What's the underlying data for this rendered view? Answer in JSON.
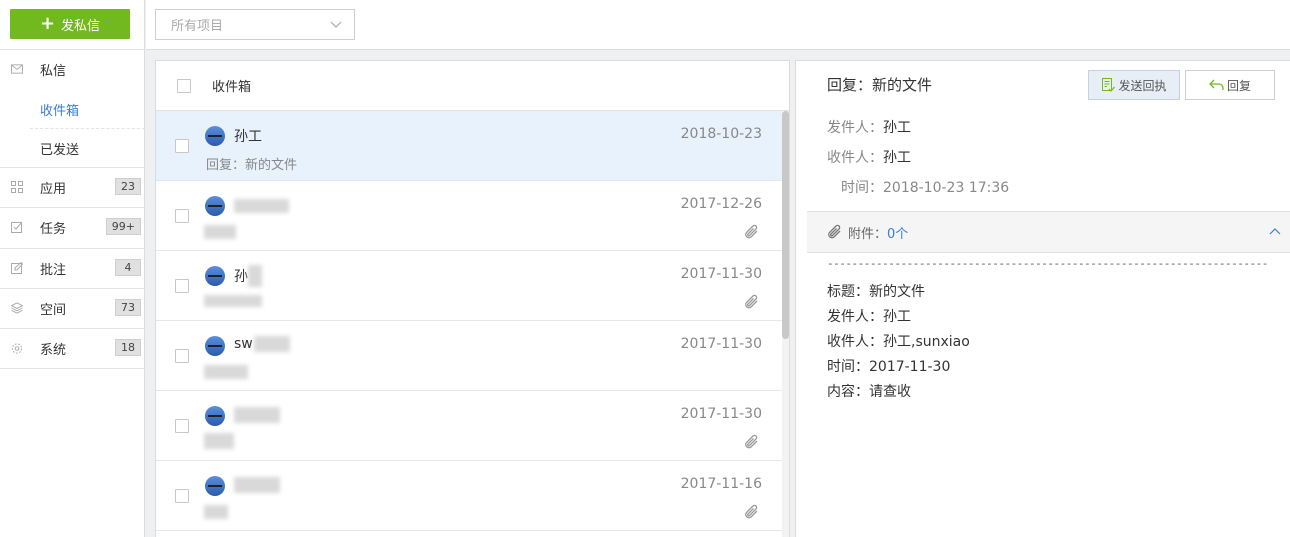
{
  "sidebar": {
    "compose_label": "发私信",
    "sections": [
      {
        "label": "私信",
        "icon": "mail-icon"
      },
      {
        "label": "应用",
        "icon": "apps-icon",
        "badge": "23"
      },
      {
        "label": "任务",
        "icon": "task-icon",
        "badge": "99+"
      },
      {
        "label": "批注",
        "icon": "annotation-icon",
        "badge": "4"
      },
      {
        "label": "空间",
        "icon": "layers-icon",
        "badge": "73"
      },
      {
        "label": "系统",
        "icon": "gear-icon",
        "badge": "18"
      }
    ],
    "sub_items": [
      {
        "label": "收件箱",
        "active": true
      },
      {
        "label": "已发送",
        "active": false
      }
    ]
  },
  "topbar": {
    "filter_placeholder": "所有项目"
  },
  "list": {
    "header": "收件箱",
    "messages": [
      {
        "sender": "孙工",
        "subject": "回复：新的文件",
        "date": "2018-10-23",
        "attachment": false,
        "selected": true
      },
      {
        "sender": "",
        "subject": "",
        "date": "2017-12-26",
        "attachment": true,
        "selected": false
      },
      {
        "sender": "孙",
        "subject": "",
        "date": "2017-11-30",
        "attachment": true,
        "selected": false
      },
      {
        "sender": "sw",
        "subject": "",
        "date": "2017-11-30",
        "attachment": false,
        "selected": false
      },
      {
        "sender": "",
        "subject": "",
        "date": "2017-11-30",
        "attachment": true,
        "selected": false
      },
      {
        "sender": "",
        "subject": "",
        "date": "2017-11-16",
        "attachment": true,
        "selected": false
      }
    ]
  },
  "detail": {
    "title": "回复：新的文件",
    "receipt_button": "发送回执",
    "reply_button": "回复",
    "sender_label": "发件人：",
    "sender_value": "孙工",
    "recipient_label": "收件人：",
    "recipient_value": "孙工",
    "time_label": "时间：",
    "time_value": "2018-10-23 17:36",
    "attachment_label": "附件：",
    "attachment_count": "0个",
    "divider": "------------------------------------------------------------------------",
    "quoted": [
      "标题：新的文件",
      "发件人：孙工",
      "收件人：孙工,sunxiao",
      "时间：2017-11-30",
      "内容：请查收"
    ]
  },
  "colors": {
    "accent_green": "#72b81f",
    "link_blue": "#3a7fd6",
    "selected_row": "#e8f2fc"
  }
}
